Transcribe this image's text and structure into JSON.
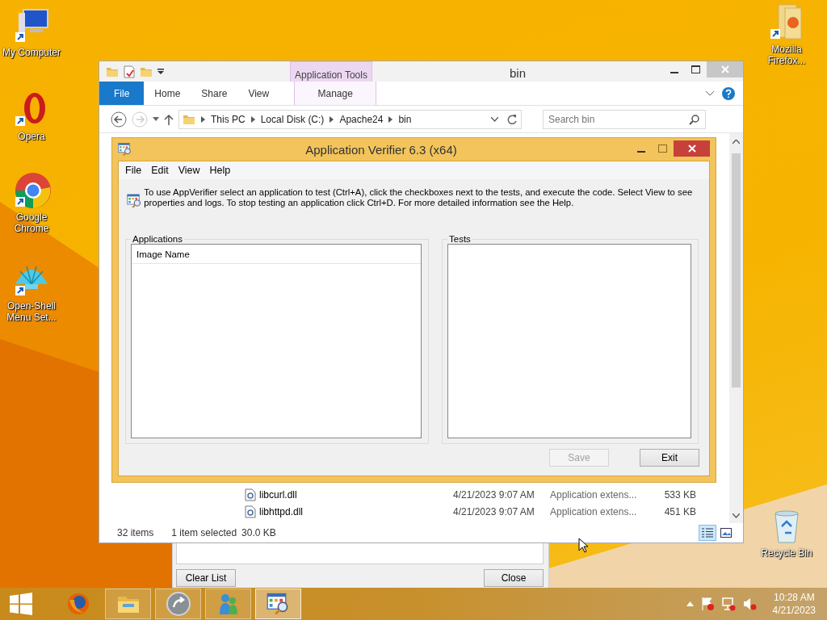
{
  "desktop_icons_left": [
    {
      "label": "My Computer",
      "kind": "computer"
    },
    {
      "label": "Opera",
      "kind": "opera"
    },
    {
      "label": "Google Chrome",
      "kind": "chrome"
    },
    {
      "label": "Open-Shell Menu Set...",
      "kind": "shell"
    }
  ],
  "desktop_icons_right": [
    {
      "label": "Mozilla Firefox...",
      "kind": "folder"
    },
    {
      "label": "Recycle Bin",
      "kind": "bin"
    }
  ],
  "background_dialog": {
    "buttons": [
      "Clear List",
      "Close"
    ]
  },
  "explorer": {
    "title": "bin",
    "context_tab": "Application Tools",
    "ribbon_tabs": [
      {
        "label": "File",
        "kind": "file"
      },
      {
        "label": "Home",
        "kind": "tab"
      },
      {
        "label": "Share",
        "kind": "tab"
      },
      {
        "label": "View",
        "kind": "tab"
      },
      {
        "label": "Manage",
        "kind": "context"
      }
    ],
    "breadcrumb": [
      "This PC",
      "Local Disk (C:)",
      "Apache24",
      "bin"
    ],
    "search": {
      "placeholder": "Search bin"
    },
    "files": [
      {
        "name": "libcurl.dll",
        "date": "4/21/2023 9:07 AM",
        "type": "Application extens...",
        "size": "533 KB"
      },
      {
        "name": "libhttpd.dll",
        "date": "4/21/2023 9:07 AM",
        "type": "Application extens...",
        "size": "451 KB"
      }
    ],
    "status": {
      "count": "32 items",
      "selection": "1 item selected",
      "size": "30.0 KB"
    },
    "view_buttons": [
      {
        "kind": "details",
        "selected": true
      },
      {
        "kind": "tiles",
        "selected": false
      }
    ]
  },
  "verifier": {
    "title": "Application Verifier 6.3 (x64)",
    "menu": [
      "File",
      "Edit",
      "View",
      "Help"
    ],
    "info": "To use AppVerifier select an application to test (Ctrl+A), click the checkboxes next to the tests, and execute the code. Select View to see properties and logs. To stop testing an application click Ctrl+D. For more detailed information see the Help.",
    "applications": {
      "label": "Applications",
      "column": "Image Name"
    },
    "tests": {
      "label": "Tests"
    },
    "buttons": [
      {
        "label": "Save",
        "disabled": true
      },
      {
        "label": "Exit",
        "disabled": false
      }
    ]
  },
  "taskbar": {
    "apps": [
      {
        "kind": "firefox",
        "running": false,
        "selected": false
      },
      {
        "kind": "explorer",
        "running": true,
        "selected": false
      },
      {
        "kind": "shell",
        "running": true,
        "selected": false
      },
      {
        "kind": "messenger",
        "running": true,
        "selected": false
      },
      {
        "kind": "verifier",
        "running": true,
        "selected": true
      }
    ],
    "clock": {
      "time": "10:28 AM",
      "date": "4/21/2023"
    }
  }
}
